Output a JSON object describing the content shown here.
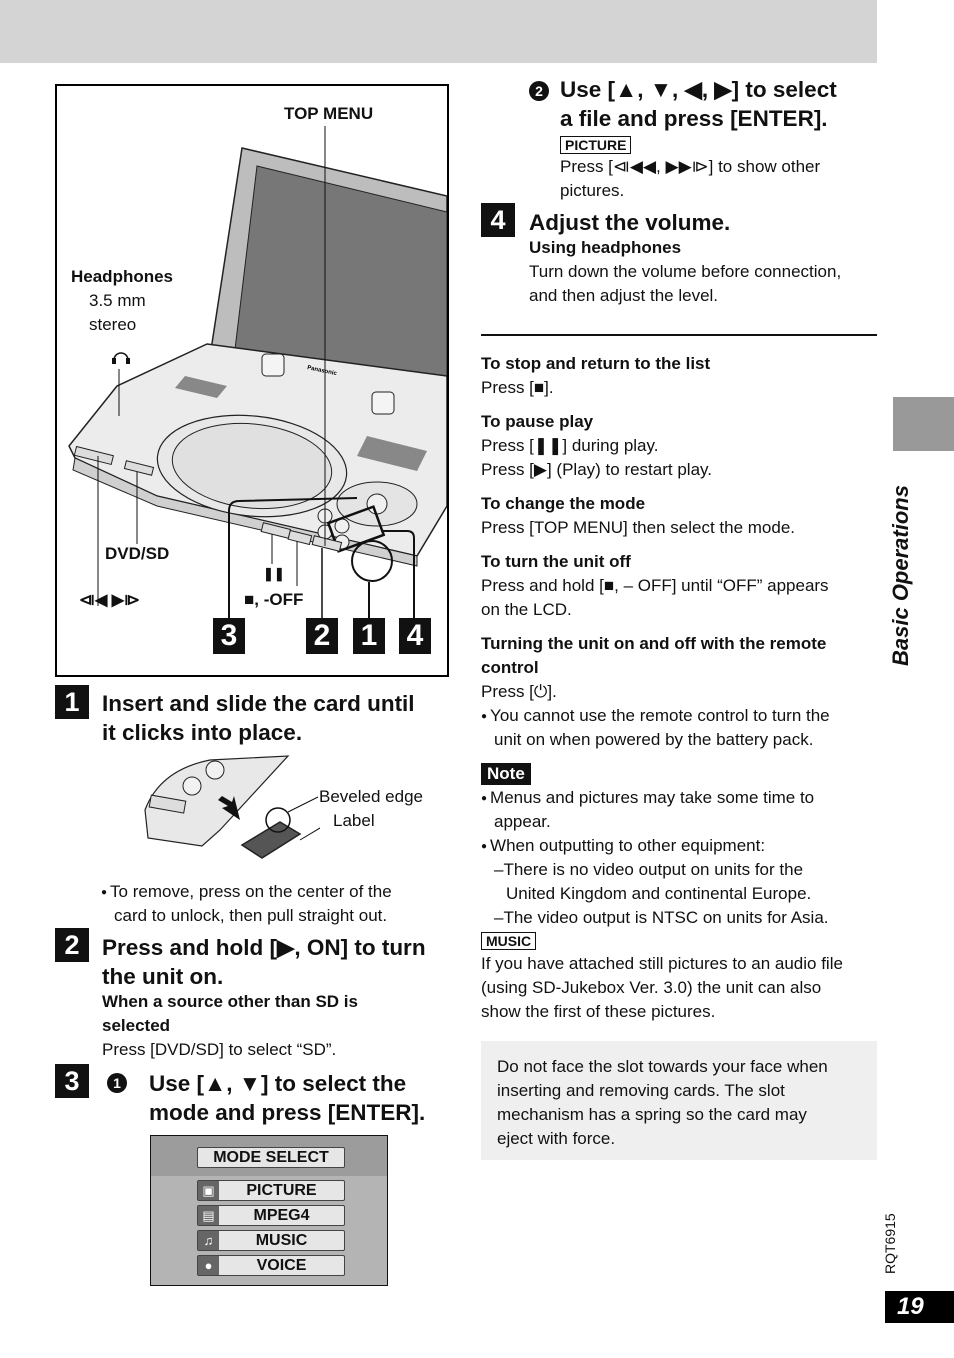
{
  "page": {
    "section_tab": "Basic Operations",
    "doc_code": "RQT6915",
    "page_number": "19"
  },
  "figure": {
    "labels": {
      "top_menu": "TOP MENU",
      "headphones": "Headphones",
      "headphones_spec_1": "3.5 mm",
      "headphones_spec_2": "stereo",
      "dvd_sd": "DVD/SD",
      "skip": "⧏◀ ▶⧐",
      "pause": "❚❚",
      "stop_off": "■, -OFF",
      "brand": "Panasonic"
    },
    "callout_numbers": [
      "3",
      "2",
      "1",
      "4"
    ]
  },
  "steps": {
    "step1": {
      "number": "1",
      "title_line1": "Insert and slide the card until",
      "title_line2": "it clicks into place.",
      "card_labels": {
        "beveled_edge": "Beveled edge",
        "label": "Label"
      },
      "bullet_line1": "To remove, press on the center of the",
      "bullet_line2": "card to unlock, then pull straight out."
    },
    "step2": {
      "number": "2",
      "title_line1": "Press and hold [▶, ON] to turn",
      "title_line2": "the unit on.",
      "sub_heading_line1": "When a source other than SD is",
      "sub_heading_line2": "selected",
      "text": "Press [DVD/SD] to select “SD”."
    },
    "step3": {
      "number": "3",
      "sub1_num": "1",
      "sub1_title_line1": "Use [▲, ▼] to select the",
      "sub1_title_line2": "mode and press [ENTER].",
      "mode_select": {
        "title": "MODE SELECT",
        "items": [
          {
            "icon": "camera-icon",
            "glyph": "▣",
            "label": "PICTURE"
          },
          {
            "icon": "film-icon",
            "glyph": "▤",
            "label": "MPEG4"
          },
          {
            "icon": "music-note-icon",
            "glyph": "♫",
            "label": "MUSIC"
          },
          {
            "icon": "microphone-icon",
            "glyph": "●",
            "label": "VOICE"
          }
        ]
      },
      "sub2_num": "2",
      "sub2_title_line1": "Use [▲, ▼, ◀, ▶] to select",
      "sub2_title_line2": "a file and press [ENTER].",
      "picture_tag": "PICTURE",
      "picture_text_line1": "Press [⧏◀◀, ▶▶⧐] to show other",
      "picture_text_line2": "pictures."
    },
    "step4": {
      "number": "4",
      "title": "Adjust the volume.",
      "sub_heading": "Using headphones",
      "text_line1": "Turn down the volume before connection,",
      "text_line2": "and then adjust the level."
    }
  },
  "tips": [
    {
      "heading": "To stop and return to the list",
      "lines": [
        "Press [■]."
      ]
    },
    {
      "heading": "To pause play",
      "lines": [
        "Press [❚❚] during play.",
        "Press [▶] (Play) to restart play."
      ]
    },
    {
      "heading": "To change the mode",
      "lines": [
        "Press [TOP MENU] then select the mode."
      ]
    },
    {
      "heading": "To turn the unit off",
      "lines": [
        "Press and hold [■, – OFF] until “OFF” appears",
        "on the LCD."
      ]
    },
    {
      "heading_line1": "Turning the unit on and off with the remote",
      "heading_line2": "control",
      "lines": [
        "Press [⏻]."
      ],
      "bullet_line1": "You cannot use the remote control to turn the",
      "bullet_line2": "unit on when powered by the battery pack."
    }
  ],
  "note": {
    "tag": "Note",
    "bullet1_line1": "Menus and pictures may take some time to",
    "bullet1_line2": "appear.",
    "bullet2": "When outputting to other equipment:",
    "dash1_line1": "–There is no video output on units for the",
    "dash1_line2": "United Kingdom and continental Europe.",
    "dash2": "–The video output is NTSC on units for Asia.",
    "music_tag": "MUSIC",
    "music_line1": "If you have attached still pictures to an audio file",
    "music_line2": "(using SD-Jukebox Ver. 3.0) the unit can also",
    "music_line3": "show the first of these pictures."
  },
  "warning": {
    "line1": "Do not face the slot towards your face when",
    "line2": "inserting and removing cards. The slot",
    "line3": "mechanism has a spring so the card may",
    "line4": "eject with force."
  },
  "colors": {
    "header_band": "#d4d4d4",
    "side_tab": "#999999",
    "warning_bg": "#efefef",
    "screen": "#777777"
  }
}
